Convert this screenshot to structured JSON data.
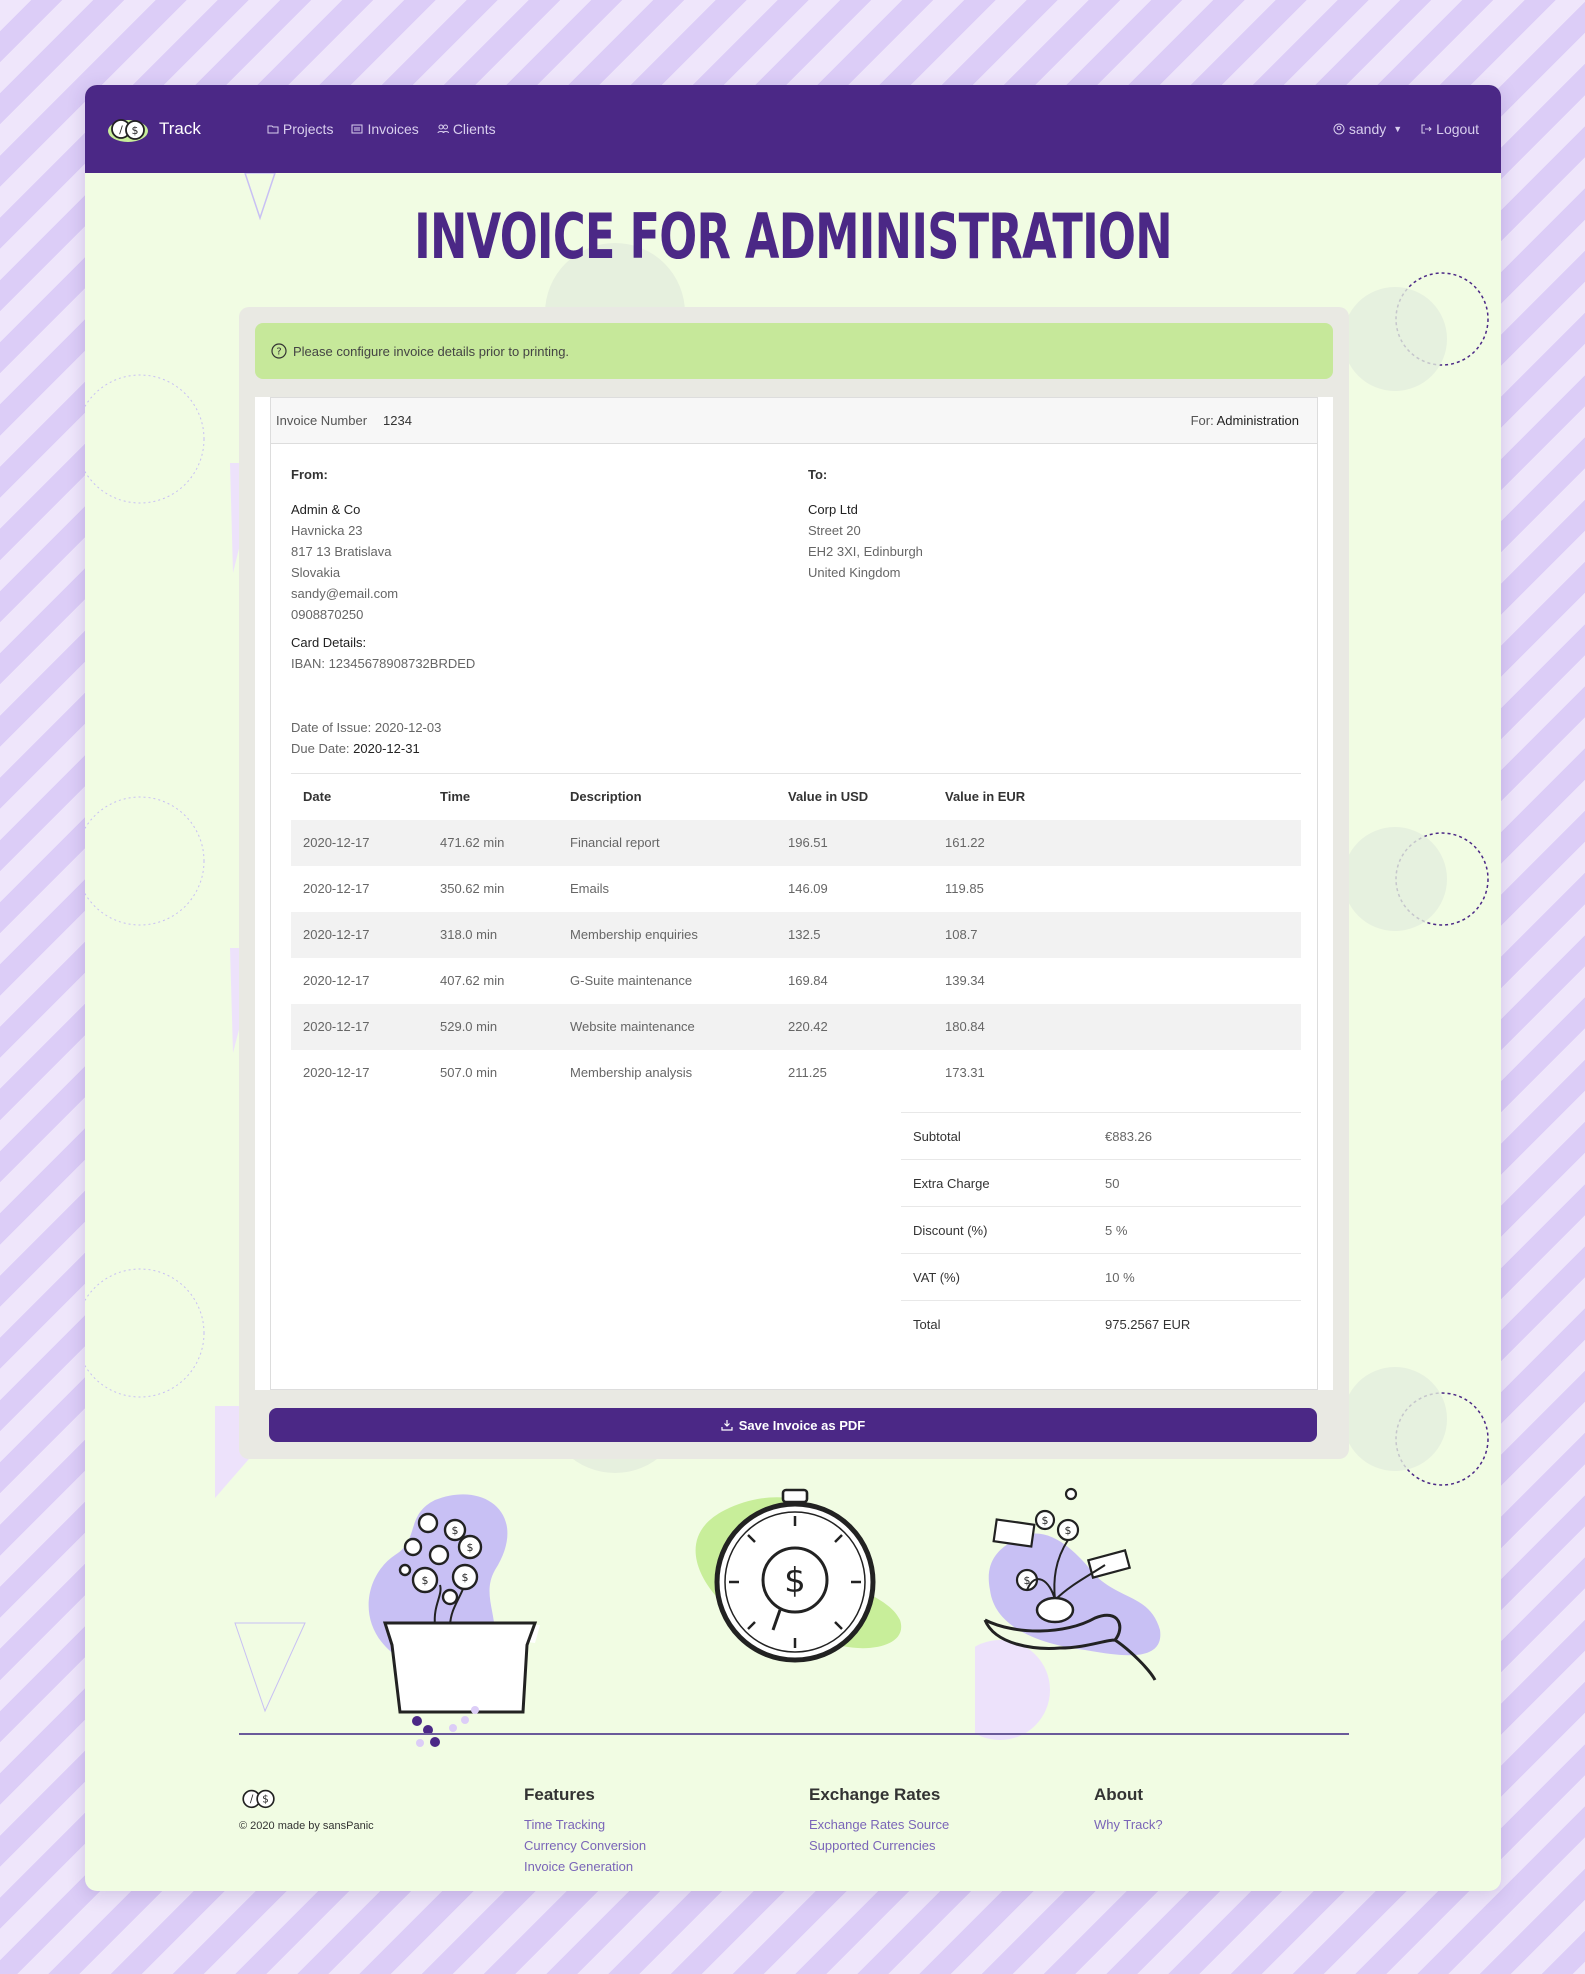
{
  "nav": {
    "brand": "Track",
    "links": [
      {
        "label": "Projects",
        "icon": "folder-icon"
      },
      {
        "label": "Invoices",
        "icon": "invoice-icon"
      },
      {
        "label": "Clients",
        "icon": "users-icon"
      }
    ],
    "user": "sandy",
    "logout": "Logout"
  },
  "page": {
    "title": "INVOICE FOR ADMINISTRATION"
  },
  "alert": {
    "text": "Please configure invoice details prior to printing."
  },
  "invoice": {
    "number_label": "Invoice Number",
    "number": "1234",
    "for_label": "For:",
    "for_value": "Administration",
    "from": {
      "label": "From:",
      "name": "Admin & Co",
      "lines": [
        "Havnicka 23",
        "817 13 Bratislava",
        "Slovakia",
        "sandy@email.com",
        "0908870250"
      ],
      "card_label": "Card Details:",
      "iban": "IBAN: 12345678908732BRDED"
    },
    "to": {
      "label": "To:",
      "name": "Corp Ltd",
      "lines": [
        "Street 20",
        "EH2 3XI, Edinburgh",
        "United Kingdom"
      ]
    },
    "issue_label": "Date of Issue:",
    "issue_date": "2020-12-03",
    "due_label": "Due Date:",
    "due_date": "2020-12-31",
    "columns": [
      "Date",
      "Time",
      "Description",
      "Value in USD",
      "Value in EUR"
    ],
    "rows": [
      [
        "2020-12-17",
        "471.62 min",
        "Financial report",
        "196.51",
        "161.22"
      ],
      [
        "2020-12-17",
        "350.62 min",
        "Emails",
        "146.09",
        "119.85"
      ],
      [
        "2020-12-17",
        "318.0 min",
        "Membership enquiries",
        "132.5",
        "108.7"
      ],
      [
        "2020-12-17",
        "407.62 min",
        "G-Suite maintenance",
        "169.84",
        "139.34"
      ],
      [
        "2020-12-17",
        "529.0 min",
        "Website maintenance",
        "220.42",
        "180.84"
      ],
      [
        "2020-12-17",
        "507.0 min",
        "Membership analysis",
        "211.25",
        "173.31"
      ]
    ],
    "summary": [
      {
        "label": "Subtotal",
        "value": "€883.26"
      },
      {
        "label": "Extra Charge",
        "value": "50"
      },
      {
        "label": "Discount (%)",
        "value": "5 %"
      },
      {
        "label": "VAT (%)",
        "value": "10 %"
      },
      {
        "label": "Total",
        "value": "975.2567 EUR"
      }
    ],
    "save_label": "Save Invoice as PDF"
  },
  "footer": {
    "copyright": "© 2020 made by sansPanic",
    "columns": [
      {
        "title": "Features",
        "links": [
          "Time Tracking",
          "Currency Conversion",
          "Invoice Generation"
        ]
      },
      {
        "title": "Exchange Rates",
        "links": [
          "Exchange Rates Source",
          "Supported Currencies"
        ]
      },
      {
        "title": "About",
        "links": [
          "Why Track?"
        ]
      }
    ]
  },
  "colors": {
    "brand": "#4b2886",
    "page_bg": "#f1fce3",
    "alert_bg": "#c6e89a",
    "accent_lavender": "#c8c0f4",
    "accent_green": "#c8ee9a"
  }
}
